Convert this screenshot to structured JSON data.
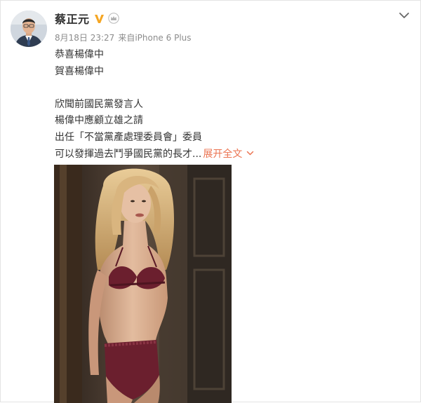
{
  "post": {
    "username": "蔡正元",
    "date": "8月18日 23:27",
    "source": "来自iPhone 6 Plus",
    "lines": [
      "恭喜楊偉中",
      "賀喜楊偉中",
      "",
      "欣聞前國民黨發言人",
      "楊偉中應顧立雄之請",
      "出任「不當黨產處理委員會」委員",
      "可以發揮過去鬥爭國民黨的長才..."
    ],
    "expand_label": "展开全文",
    "icons": {
      "verified": "verified-v-icon",
      "membership": "crown-icon",
      "menu": "chevron-down-icon",
      "expand": "chevron-down-icon"
    },
    "colors": {
      "accent": "#eb7350",
      "verified": "#f5a623",
      "text": "#333333",
      "meta": "#8c8c8c"
    }
  }
}
